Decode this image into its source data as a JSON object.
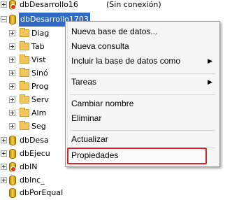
{
  "tree": {
    "top_item": {
      "label": "dbDesarrollo16",
      "status": "(Sin conexión)"
    },
    "selected_item": {
      "label": "dbDesarrollo1703"
    },
    "children": [
      "Diag",
      "Tab",
      "Vist",
      "Sinó",
      "Prog",
      "Serv",
      "Alm",
      "Seg"
    ],
    "after_items": [
      "dbDesa",
      "dbEjecu",
      "dbIN",
      "dbInc_",
      "dbPorEqual"
    ]
  },
  "context_menu": {
    "items": [
      {
        "label": "Nueva base de datos...",
        "has_submenu": false
      },
      {
        "label": "Nueva consulta",
        "has_submenu": false
      },
      {
        "label": "Incluir la base de datos como",
        "has_submenu": true
      },
      {
        "label": "Tareas",
        "has_submenu": true
      },
      {
        "label": "Cambiar nombre",
        "has_submenu": false
      },
      {
        "label": "Eliminar",
        "has_submenu": false
      },
      {
        "label": "Actualizar",
        "has_submenu": false
      },
      {
        "label": "Propiedades",
        "has_submenu": false
      }
    ],
    "highlighted_item": "Propiedades",
    "highlight_color": "#dd2222"
  },
  "colors": {
    "selection": "#316ac5"
  }
}
